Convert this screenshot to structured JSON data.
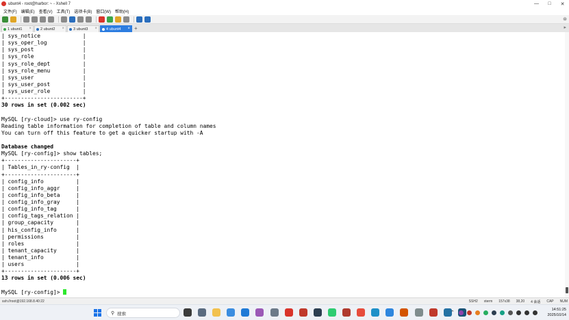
{
  "window": {
    "title": "ubunt4 - root@harbor: ~ - Xshell 7"
  },
  "menu": [
    "文件(F)",
    "编辑(E)",
    "查看(V)",
    "工具(T)",
    "选项卡(B)",
    "窗口(W)",
    "帮助(H)"
  ],
  "toolbar_icons": [
    {
      "name": "new-session-icon",
      "color": "#3a8f3a"
    },
    {
      "name": "open-folder-icon",
      "color": "#e0a526"
    },
    {
      "name": "reconnect-icon",
      "color": "#8a8a8a"
    },
    {
      "name": "copy-icon",
      "color": "#8a8a8a"
    },
    {
      "name": "paste-icon",
      "color": "#8a8a8a"
    },
    {
      "name": "find-icon",
      "color": "#8a8a8a"
    },
    {
      "name": "print-icon",
      "color": "#8a8a8a"
    },
    {
      "name": "globe-icon",
      "color": "#2a6ebd"
    },
    {
      "name": "color-scheme-icon",
      "color": "#8a8a8a"
    },
    {
      "name": "keyboard-icon",
      "color": "#8a8a8a"
    },
    {
      "name": "xftp-icon",
      "color": "#d9342b"
    },
    {
      "name": "transfer-icon",
      "color": "#3aa64a"
    },
    {
      "name": "lock-icon",
      "color": "#e0a526"
    },
    {
      "name": "layout-icon",
      "color": "#8a8a8a"
    },
    {
      "name": "help-icon",
      "color": "#2a6ebd"
    },
    {
      "name": "notification-icon",
      "color": "#2a6ebd"
    }
  ],
  "tabs": [
    {
      "label": "1 ubunt1",
      "dot": "#3aa64a",
      "active": false
    },
    {
      "label": "2 ubunt2",
      "dot": "#2a6ebd",
      "active": false
    },
    {
      "label": "3 ubunt3",
      "dot": "#2a6ebd",
      "active": false
    },
    {
      "label": "4 ubunt4",
      "dot": "#ffffff",
      "active": true
    }
  ],
  "terminal_lines": [
    {
      "text": "| sys_notice             |",
      "bold": false
    },
    {
      "text": "| sys_oper_log           |",
      "bold": false
    },
    {
      "text": "| sys_post               |",
      "bold": false
    },
    {
      "text": "| sys_role               |",
      "bold": false
    },
    {
      "text": "| sys_role_dept          |",
      "bold": false
    },
    {
      "text": "| sys_role_menu          |",
      "bold": false
    },
    {
      "text": "| sys_user               |",
      "bold": false
    },
    {
      "text": "| sys_user_post          |",
      "bold": false
    },
    {
      "text": "| sys_user_role          |",
      "bold": false
    },
    {
      "text": "+------------------------+",
      "bold": false
    },
    {
      "text": "30 rows in set (0.002 sec)",
      "bold": true
    },
    {
      "text": "",
      "bold": false
    },
    {
      "text": "MySQL [ry-cloud]> use ry-config",
      "bold": false
    },
    {
      "text": "Reading table information for completion of table and column names",
      "bold": false
    },
    {
      "text": "You can turn off this feature to get a quicker startup with -A",
      "bold": false
    },
    {
      "text": "",
      "bold": false
    },
    {
      "text": "Database changed",
      "bold": true
    },
    {
      "text": "MySQL [ry-config]> show tables;",
      "bold": false
    },
    {
      "text": "+----------------------+",
      "bold": false
    },
    {
      "text": "| Tables_in_ry-config  |",
      "bold": false
    },
    {
      "text": "+----------------------+",
      "bold": false
    },
    {
      "text": "| config_info          |",
      "bold": false
    },
    {
      "text": "| config_info_aggr     |",
      "bold": false
    },
    {
      "text": "| config_info_beta     |",
      "bold": false
    },
    {
      "text": "| config_info_gray     |",
      "bold": false
    },
    {
      "text": "| config_info_tag      |",
      "bold": false
    },
    {
      "text": "| config_tags_relation |",
      "bold": false
    },
    {
      "text": "| group_capacity       |",
      "bold": false
    },
    {
      "text": "| his_config_info      |",
      "bold": false
    },
    {
      "text": "| permissions          |",
      "bold": false
    },
    {
      "text": "| roles                |",
      "bold": false
    },
    {
      "text": "| tenant_capacity      |",
      "bold": false
    },
    {
      "text": "| tenant_info          |",
      "bold": false
    },
    {
      "text": "| users                |",
      "bold": false
    },
    {
      "text": "+----------------------+",
      "bold": false
    },
    {
      "text": "13 rows in set (0.006 sec)",
      "bold": true
    },
    {
      "text": "",
      "bold": false
    }
  ],
  "prompt": "MySQL [ry-config]> ",
  "statusbar": {
    "connection": "ssh://root@192.168.8.40:22",
    "protocol": "SSH2",
    "terminal": "xterm",
    "size": "157x38",
    "cursor_pos": "38,20",
    "sessions": "4 会话",
    "caps": "CAP",
    "num": "NUM"
  },
  "taskbar": {
    "search_placeholder": "搜索",
    "apps": [
      {
        "name": "task-view-icon",
        "color": "#3b3b3b"
      },
      {
        "name": "settings-icon",
        "color": "#5a6b80"
      },
      {
        "name": "file-explorer-icon",
        "color": "#f2c14e"
      },
      {
        "name": "browser-icon",
        "color": "#3b8de0"
      },
      {
        "name": "vscode-icon",
        "color": "#1f7ad6"
      },
      {
        "name": "toolbox-icon",
        "color": "#9b59b6"
      },
      {
        "name": "app-icon",
        "color": "#6c7a89"
      },
      {
        "name": "xshell-icon",
        "color": "#d9342b"
      },
      {
        "name": "chat-icon",
        "color": "#c0392b"
      },
      {
        "name": "terminal-icon",
        "color": "#2c3e50"
      },
      {
        "name": "wechat-icon",
        "color": "#2ecc71"
      },
      {
        "name": "notes-icon",
        "color": "#b03a2e"
      },
      {
        "name": "chrome-icon",
        "color": "#e74c3c"
      },
      {
        "name": "edge-icon",
        "color": "#1e90c8"
      },
      {
        "name": "feishu-icon",
        "color": "#2e86de"
      },
      {
        "name": "photos-icon",
        "color": "#d35400"
      },
      {
        "name": "tool-icon",
        "color": "#7f8c8d"
      },
      {
        "name": "xftp-icon",
        "color": "#c0392b"
      },
      {
        "name": "screen-icon",
        "color": "#2471a3"
      },
      {
        "name": "vpn-icon",
        "color": "#1a5276"
      }
    ],
    "tray_icons": [
      {
        "name": "tray-app-icon",
        "color": "#8e44ad"
      },
      {
        "name": "tray-app-icon",
        "color": "#c0392b"
      },
      {
        "name": "tray-app-icon",
        "color": "#e67e22"
      },
      {
        "name": "tray-wechat-icon",
        "color": "#27ae60"
      },
      {
        "name": "tray-app-icon",
        "color": "#2c3e50"
      },
      {
        "name": "tray-app-icon",
        "color": "#16a085"
      },
      {
        "name": "tray-ime-icon",
        "color": "#555555"
      },
      {
        "name": "tray-wifi-icon",
        "color": "#333333"
      },
      {
        "name": "tray-volume-icon",
        "color": "#333333"
      },
      {
        "name": "tray-battery-icon",
        "color": "#333333"
      }
    ],
    "time": "14:51:25",
    "date": "2025/10/14"
  }
}
